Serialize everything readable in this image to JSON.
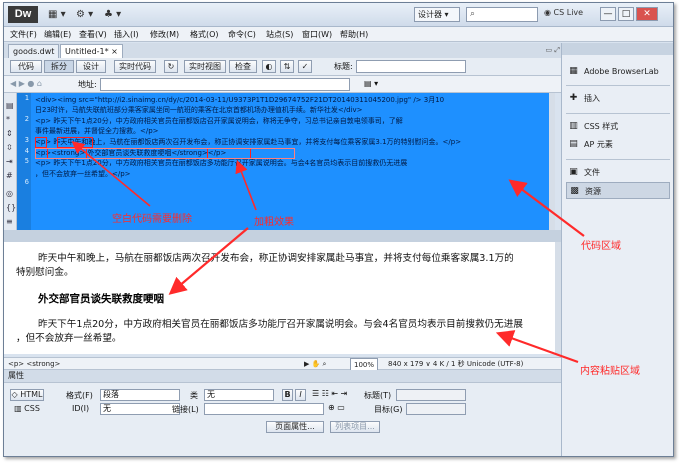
{
  "app": {
    "logo": "Dw",
    "designer": "设计器 ▾",
    "cs_live": "CS Live",
    "window_buttons": [
      "—",
      "□",
      "✕"
    ]
  },
  "menu": [
    "文件(F)",
    "编辑(E)",
    "查看(V)",
    "插入(I)",
    "修改(M)",
    "格式(O)",
    "命令(C)",
    "站点(S)",
    "窗口(W)",
    "帮助(H)"
  ],
  "tabs": [
    "goods.dwt",
    "Untitled-1*"
  ],
  "document_toolbar": {
    "buttons": [
      "代码",
      "拆分",
      "设计",
      "实时代码",
      "实时视图",
      "检查"
    ],
    "title_label": "标题:"
  },
  "address_label": "地址:",
  "code": {
    "line_numbers": [
      "1",
      "",
      "2",
      "",
      "3",
      "4",
      "5",
      "",
      "6"
    ],
    "lines": [
      "<div><img src=\"http://i2.sinaimg.cn/dy/c/2014-03-11/U9373P1T1D29674752F21DT20140311045200.jpg\" />    3月10",
      "日23时许，马航失联航班部分乘客家属坐同一航班的乘客在北京首都机场办理值机手续。新华社发</div>",
      "<p>    昨天下午1点20分，中方政府相关官员在丽都饭店召开家属说明会，称将无争夺，习总书记亲自敦电领事司，了解",
      "事件最新进展，并督促全力搜救。</p>",
      "<p>        昨天中午和晚上，马航在丽都饭店两次召开发布会，称正协调安排家属赴马事宜，并将支付每位乘客家属3.1万的特别慰问金。</p>",
      "<p><strong>       外交部官员谈失联救度哽咽</strong></p>",
      "<p>    昨天下午1点20分，中方政府相关官员在丽都饭店多功能厅召开家属说明会。与会4名官员均表示目前搜救仍无进展",
      "，但不会放弃一丝希望。</p>"
    ]
  },
  "design": {
    "para1_line1": "昨天中午和晚上，马航在丽都饭店两次召开发布会，称正协调安排家属赴马事宜，并将支付每位乘客家属3.1万的",
    "para1_line2": "特别慰问金。",
    "heading": "外交部官员谈失联救度哽咽",
    "para2_line1": "昨天下午1点20分，中方政府相关官员在丽都饭店多功能厅召开家属说明会。与会4名官员均表示目前搜救仍无进展",
    "para2_line2": "，但不会放弃一丝希望。"
  },
  "status": {
    "tag": "<p> <strong>",
    "zoom": "100%",
    "info": "840 x 179 ∨  4 K / 1 秒  Unicode (UTF-8)"
  },
  "properties": {
    "title": "属性",
    "html_label": "HTML",
    "css_label": "CSS",
    "format_label": "格式(F)",
    "format_value": "段落",
    "class_label": "类",
    "class_value": "无",
    "id_label": "ID(I)",
    "id_value": "无",
    "link_label": "链接(L)",
    "title_label": "标题(T)",
    "target_label": "目标(G)",
    "bold": "B",
    "italic": "I",
    "page_props": "页面属性...",
    "list_item": "列表项目..."
  },
  "right_panel": {
    "items": [
      "Adobe BrowserLab",
      "插入",
      "CSS 样式",
      "AP 元素",
      "文件",
      "资源"
    ]
  },
  "annotations": {
    "blank_code": "空白代码需要删除",
    "bold_effect": "加粗效果",
    "code_area": "代码区域",
    "paste_area": "内容粘贴区域"
  },
  "colors": {
    "code_bg": "#1e90ff",
    "annotation": "#ff2a2a"
  }
}
